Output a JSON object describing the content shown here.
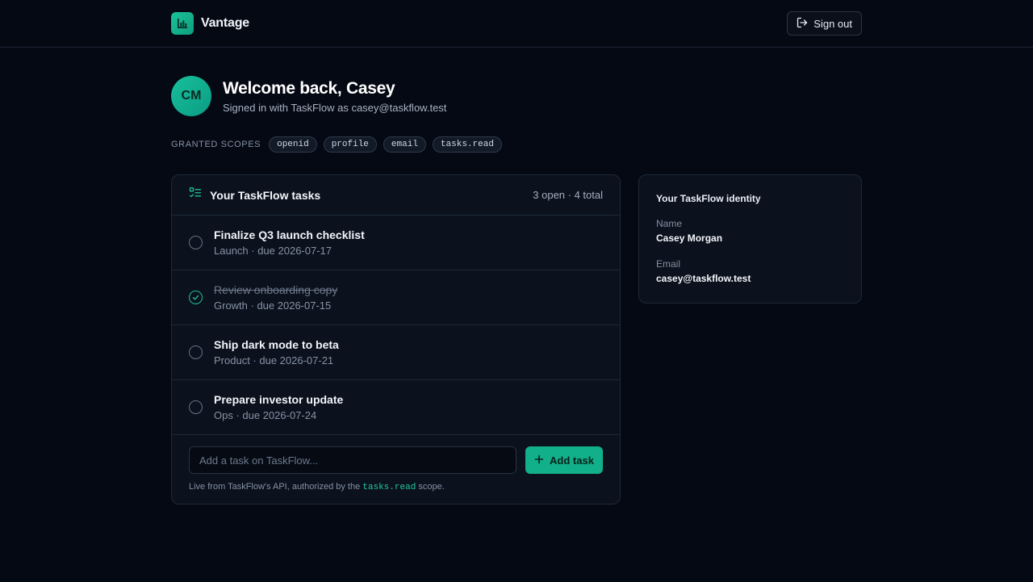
{
  "header": {
    "brand": "Vantage",
    "sign_out_label": "Sign out"
  },
  "welcome": {
    "avatar_initials": "CM",
    "title": "Welcome back, Casey",
    "subtitle": "Signed in with TaskFlow as casey@taskflow.test"
  },
  "scopes": {
    "label": "GRANTED SCOPES",
    "items": [
      "openid",
      "profile",
      "email",
      "tasks.read"
    ]
  },
  "tasks": {
    "title": "Your TaskFlow tasks",
    "count": "3 open · 4 total",
    "items": [
      {
        "title": "Finalize Q3 launch checklist",
        "meta": "Launch · due 2026-07-17",
        "done": false
      },
      {
        "title": "Review onboarding copy",
        "meta": "Growth · due 2026-07-15",
        "done": true
      },
      {
        "title": "Ship dark mode to beta",
        "meta": "Product · due 2026-07-21",
        "done": false
      },
      {
        "title": "Prepare investor update",
        "meta": "Ops · due 2026-07-24",
        "done": false
      }
    ],
    "add_placeholder": "Add a task on TaskFlow...",
    "add_button_label": "Add task",
    "footnote_prefix": "Live from TaskFlow's API, authorized by the",
    "footnote_scope": "tasks.read",
    "footnote_suffix": "scope."
  },
  "identity": {
    "title": "Your TaskFlow identity",
    "name_label": "Name",
    "name_value": "Casey Morgan",
    "email_label": "Email",
    "email_value": "casey@taskflow.test"
  },
  "colors": {
    "background": "#050914",
    "accent": "#12b08a",
    "card": "#0b111d",
    "border": "#1f2939"
  }
}
